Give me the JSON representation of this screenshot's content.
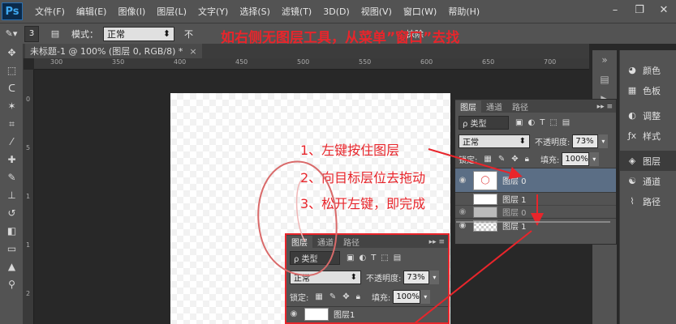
{
  "app": {
    "logo": "Ps"
  },
  "menu": [
    "文件(F)",
    "编辑(E)",
    "图像(I)",
    "图层(L)",
    "文字(Y)",
    "选择(S)",
    "滤镜(T)",
    "3D(D)",
    "视图(V)",
    "窗口(W)",
    "帮助(H)"
  ],
  "window_controls": [
    "–",
    "❐",
    "✕"
  ],
  "options": {
    "brush_size": "3",
    "mode_label": "模式：",
    "mode_value": "正常",
    "opacity_label": "不",
    "trailing_text": "抹除"
  },
  "document": {
    "tab_title": "未标题-1 @ 100% (图层 0, RGB/8) *",
    "close": "×"
  },
  "ruler": {
    "top_marks": [
      "300",
      "350",
      "400",
      "450",
      "500",
      "550",
      "600",
      "650",
      "700"
    ],
    "left_marks": [
      "0",
      "5",
      "1",
      "1",
      "2"
    ]
  },
  "annotations": {
    "top_note": "如右侧无图层工具，从菜单”窗口”去找",
    "step1": "1、左键按住图层",
    "step2": "2、向目标层位去拖动",
    "step3": "3、松开左键，即完成"
  },
  "right_dock": [
    {
      "icon": "color-icon",
      "glyph": "◕",
      "label": "颜色"
    },
    {
      "icon": "swatches-icon",
      "glyph": "▦",
      "label": "色板"
    },
    {
      "icon": "adjustments-icon",
      "glyph": "◐",
      "label": "调整"
    },
    {
      "icon": "styles-icon",
      "glyph": "ƒx",
      "label": "样式"
    },
    {
      "icon": "layers-icon",
      "glyph": "◈",
      "label": "图层"
    },
    {
      "icon": "channels-icon",
      "glyph": "☯",
      "label": "通道"
    },
    {
      "icon": "paths-icon",
      "glyph": "⌇",
      "label": "路径"
    }
  ],
  "layers_panel": {
    "tabs": [
      "图层",
      "通道",
      "路径"
    ],
    "search": "ρ 类型",
    "blend_mode": "正常",
    "opacity_label": "不透明度:",
    "opacity_value": "73%",
    "lock_label": "锁定:",
    "fill_label": "填充:",
    "fill_value": "100%",
    "layers": [
      "图层 0",
      "图层 1",
      "图层 0",
      "图层 1"
    ]
  },
  "layers_panel_zoom": {
    "tabs": [
      "图层",
      "通道",
      "路径"
    ],
    "search": "ρ 类型",
    "blend_mode": "正常",
    "opacity_label": "不透明度:",
    "opacity_value": "73%",
    "lock_label": "锁定:",
    "fill_label": "填充:",
    "fill_value": "100%",
    "layers": [
      "图层1"
    ]
  }
}
